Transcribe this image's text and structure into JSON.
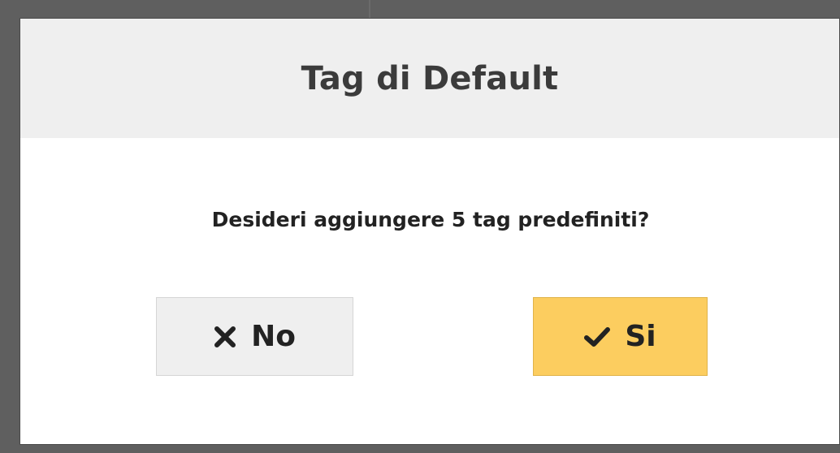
{
  "dialog": {
    "title": "Tag di Default",
    "message": "Desideri aggiungere 5 tag predefiniti?",
    "buttons": {
      "no": {
        "label": "No",
        "icon": "close-icon"
      },
      "yes": {
        "label": "Si",
        "icon": "check-icon"
      }
    }
  },
  "colors": {
    "header_bg": "#efefef",
    "yes_button_bg": "#fccd5f",
    "no_button_bg": "#efefef",
    "backdrop": "#5f5f5f"
  }
}
